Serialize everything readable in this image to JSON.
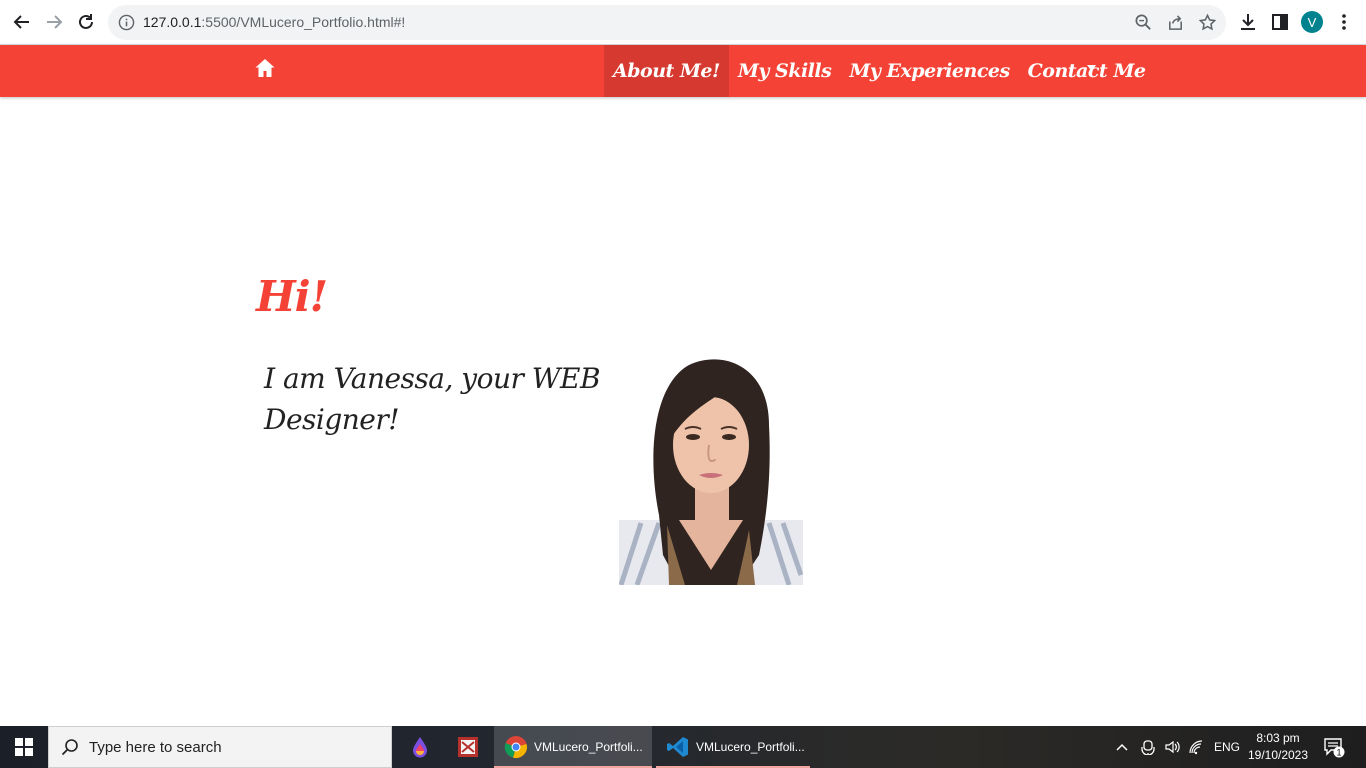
{
  "browser": {
    "url_host": "127.0.0.1",
    "url_rest": ":5500/VMLucero_Portfolio.html#!",
    "profile_initial": "V"
  },
  "navbar": {
    "links": [
      {
        "label": "About Me!",
        "active": true
      },
      {
        "label": "My Skills",
        "active": false
      },
      {
        "label": "My Experiences",
        "active": false
      },
      {
        "label": "Contact Me",
        "active": false
      }
    ],
    "accent_color": "#f44336"
  },
  "hero": {
    "greeting": "Hi!",
    "intro": "I am Vanessa, your WEB Designer!"
  },
  "taskbar": {
    "search_placeholder": "Type here to search",
    "apps": [
      {
        "name": "paint-app",
        "label": ""
      },
      {
        "name": "presentation-app",
        "label": ""
      },
      {
        "name": "chrome",
        "label": "VMLucero_Portfoli..."
      },
      {
        "name": "vscode",
        "label": "VMLucero_Portfoli..."
      }
    ],
    "language": "ENG",
    "time": "8:03 pm",
    "date": "19/10/2023",
    "notification_count": "1"
  }
}
